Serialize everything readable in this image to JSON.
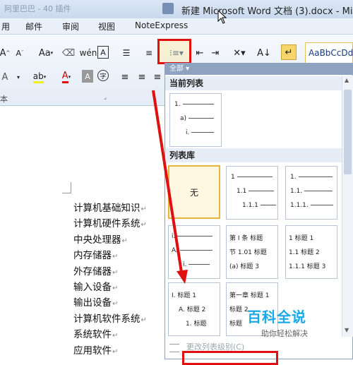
{
  "window": {
    "title": "新建 Microsoft Word 文档 (3).docx - Micr",
    "qa_blurred": "阿里巴巴 - 40 插件"
  },
  "menu": {
    "tabs": [
      "用",
      "邮件",
      "审阅",
      "视图",
      "NoteExpress"
    ]
  },
  "ribbon": {
    "font_size_up": "A",
    "font_size_down": "A",
    "change_case": "Aa",
    "phonetic": "wén",
    "char_border": "A",
    "highlight": "ab",
    "font_color": "A",
    "char_shading": "A",
    "enclose": "字",
    "sort": "A↓",
    "style_sample": "AaBbCcDd",
    "section_label": "本"
  },
  "dropdown": {
    "header": "全部",
    "current_list_label": "当前列表",
    "current_list": [
      "1.",
      "a)",
      "i."
    ],
    "library_label": "列表库",
    "none_label": "无",
    "thumb2": [
      "1",
      "1.1",
      "1.1.1"
    ],
    "thumb3": [
      "1.",
      "1.1.",
      "1.1.1."
    ],
    "thumb4": [
      "i.",
      "A.",
      "i."
    ],
    "thumb5": [
      "第 I 条 标题",
      "节 1.01 标题",
      "(a) 标题 3"
    ],
    "thumb6": [
      "1 标题 1",
      "1.1 标题 2",
      "1.1.1 标题 3"
    ],
    "thumb7": [
      "I. 标题 1",
      "A. 标题 2",
      "1. 标题"
    ],
    "thumb8": [
      "第一章 标题 1",
      "标题 2",
      "标题"
    ],
    "footer": "更改列表级别(C)"
  },
  "document": {
    "lines": [
      "计算机基础知识",
      "计算机硬件系统",
      "中央处理器",
      "内存储器",
      "外存储器",
      "输入设备",
      "输出设备",
      "计算机软件系统",
      "系统软件",
      "应用软件"
    ],
    "return_mark": "↵"
  },
  "watermark": {
    "main": "百科全说",
    "sub": "助你轻松解决"
  },
  "colors": {
    "annotation_red": "#e01010",
    "selected_border": "#e9b43a",
    "watermark_blue": "#1aa8e6"
  }
}
